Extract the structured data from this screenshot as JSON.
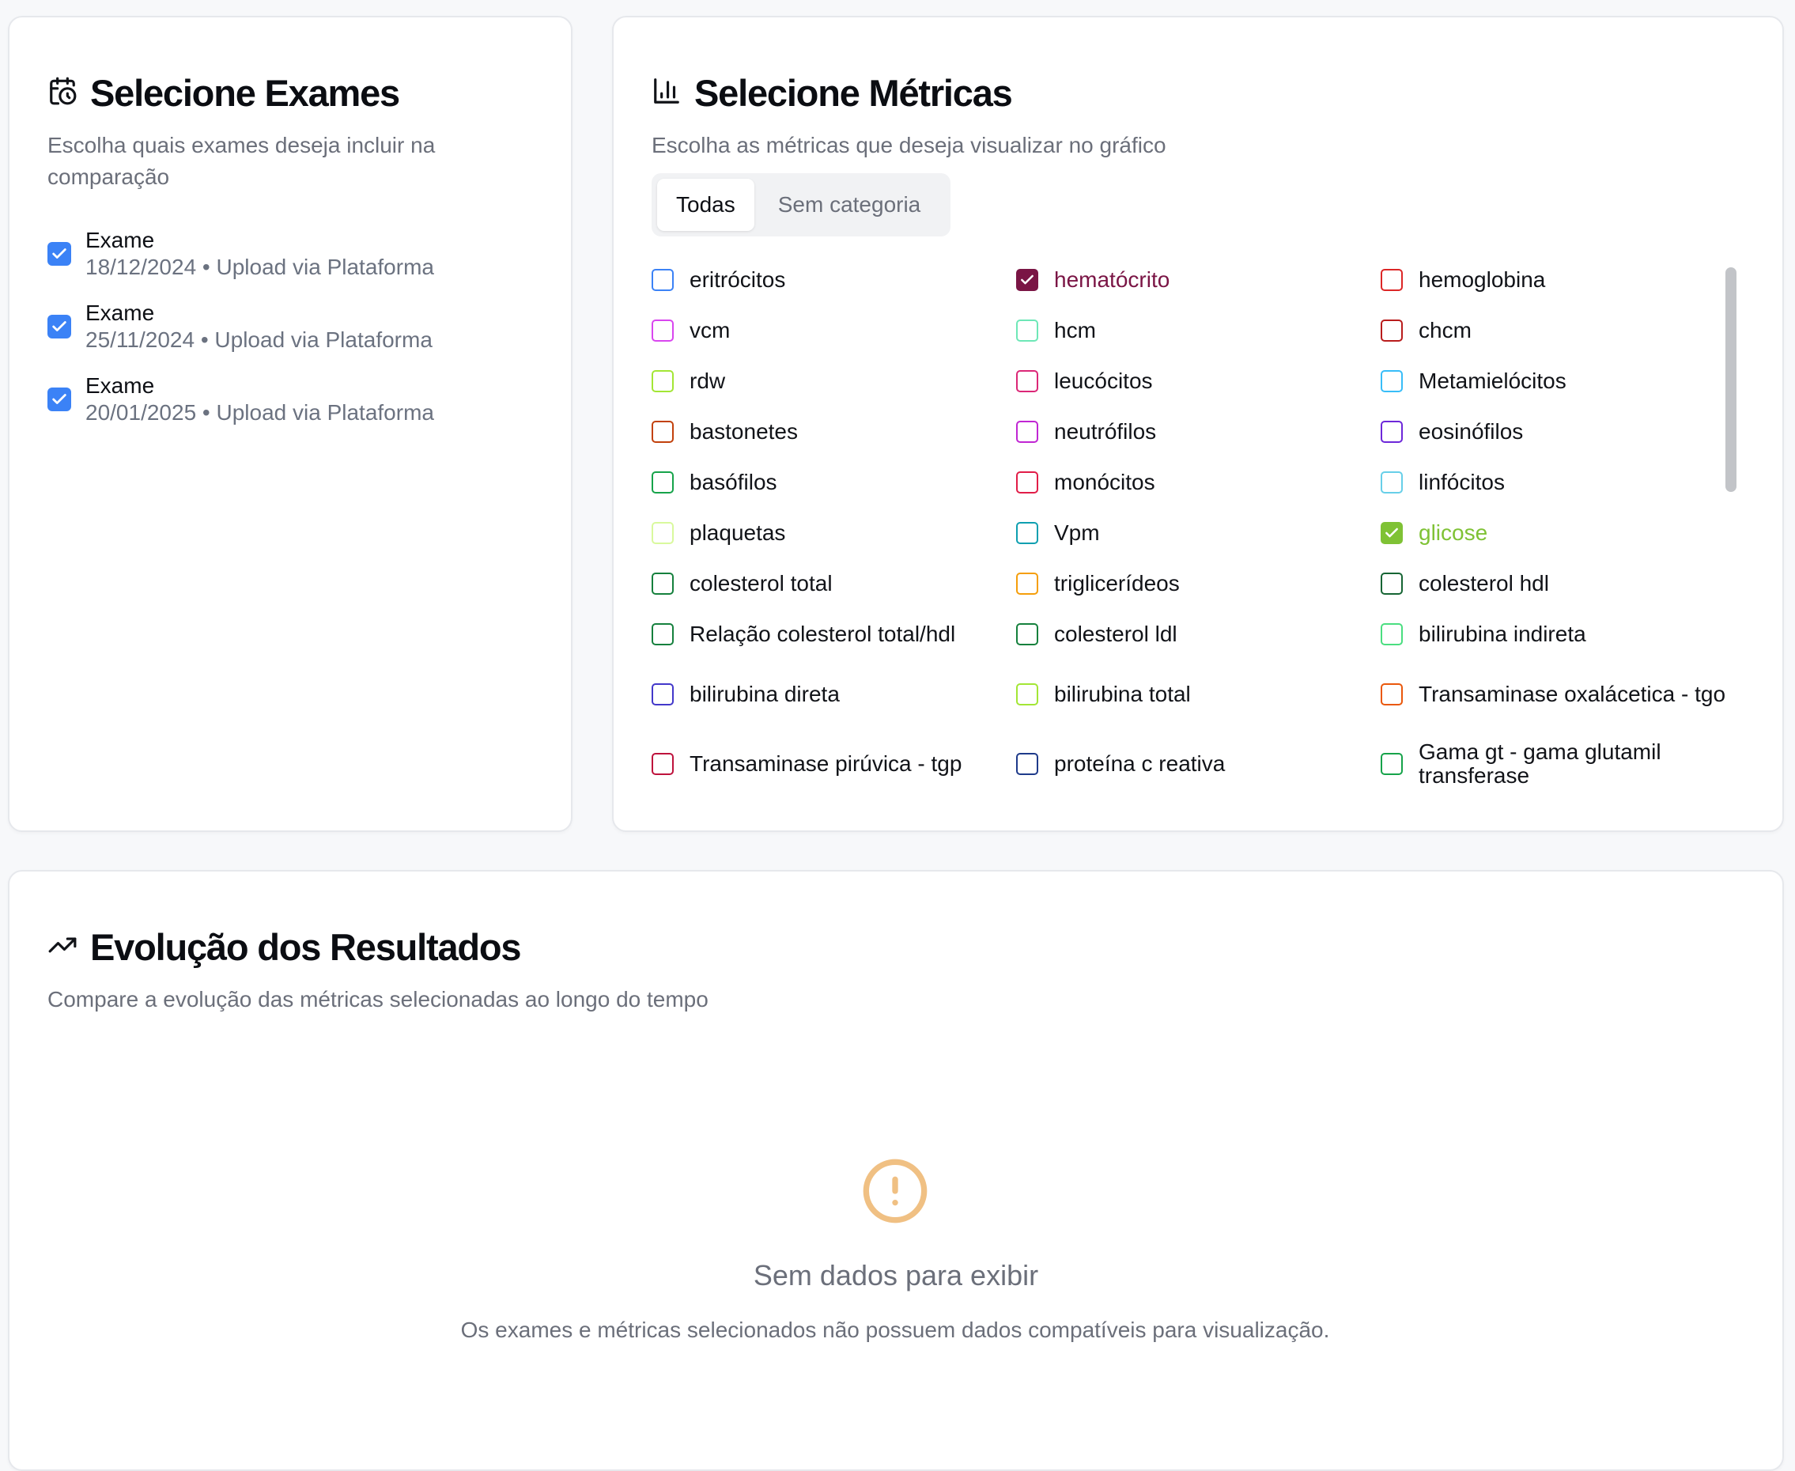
{
  "exams_panel": {
    "title": "Selecione Exames",
    "description": "Escolha quais exames deseja incluir na comparação",
    "items": [
      {
        "name": "Exame",
        "meta": "18/12/2024 • Upload via Plataforma",
        "checked": true
      },
      {
        "name": "Exame",
        "meta": "25/11/2024 • Upload via Plataforma",
        "checked": true
      },
      {
        "name": "Exame",
        "meta": "20/01/2025 • Upload via Plataforma",
        "checked": true
      }
    ]
  },
  "metrics_panel": {
    "title": "Selecione Métricas",
    "description": "Escolha as métricas que deseja visualizar no gráfico",
    "tabs": [
      {
        "label": "Todas",
        "active": true
      },
      {
        "label": "Sem categoria",
        "active": false
      }
    ],
    "metrics": [
      {
        "label": "eritrócitos",
        "color": "#3b82f6",
        "checked": false
      },
      {
        "label": "hematócrito",
        "color": "#7a1545",
        "checked": true
      },
      {
        "label": "hemoglobina",
        "color": "#dc2626",
        "checked": false
      },
      {
        "label": "vcm",
        "color": "#d946ef",
        "checked": false
      },
      {
        "label": "hcm",
        "color": "#6ee7b7",
        "checked": false
      },
      {
        "label": "chcm",
        "color": "#b91c1c",
        "checked": false
      },
      {
        "label": "rdw",
        "color": "#a3e635",
        "checked": false
      },
      {
        "label": "leucócitos",
        "color": "#db2777",
        "checked": false
      },
      {
        "label": "Metamielócitos",
        "color": "#38bdf8",
        "checked": false
      },
      {
        "label": "bastonetes",
        "color": "#c2410c",
        "checked": false
      },
      {
        "label": "neutrófilos",
        "color": "#c026d3",
        "checked": false
      },
      {
        "label": "eosinófilos",
        "color": "#6d28d9",
        "checked": false
      },
      {
        "label": "basófilos",
        "color": "#16a34a",
        "checked": false
      },
      {
        "label": "monócitos",
        "color": "#e11d48",
        "checked": false
      },
      {
        "label": "linfócitos",
        "color": "#67cfe8",
        "checked": false
      },
      {
        "label": "plaquetas",
        "color": "#d9f99d",
        "checked": false
      },
      {
        "label": "Vpm",
        "color": "#0e9fb0",
        "checked": false
      },
      {
        "label": "glicose",
        "color": "#7fc235",
        "checked": true
      },
      {
        "label": "colesterol total",
        "color": "#15803d",
        "checked": false
      },
      {
        "label": "triglicerídeos",
        "color": "#f59e0b",
        "checked": false
      },
      {
        "label": "colesterol hdl",
        "color": "#166534",
        "checked": false
      },
      {
        "label": "Relação colesterol total/hdl",
        "color": "#15803d",
        "checked": false
      },
      {
        "label": "colesterol ldl",
        "color": "#15803d",
        "checked": false
      },
      {
        "label": "bilirubina indireta",
        "color": "#4ade80",
        "checked": false
      },
      {
        "label": "bilirubina direta",
        "color": "#4338ca",
        "checked": false
      },
      {
        "label": "bilirubina total",
        "color": "#a3e635",
        "checked": false
      },
      {
        "label": "Transaminase oxalácetica - tgo",
        "color": "#ea580c",
        "checked": false
      },
      {
        "label": "Transaminase pirúvica - tgp",
        "color": "#be123c",
        "checked": false
      },
      {
        "label": "proteína c reativa",
        "color": "#1e3a8a",
        "checked": false
      },
      {
        "label": "Gama gt - gama glutamil transferase",
        "color": "#16a34a",
        "checked": false
      }
    ]
  },
  "chart_panel": {
    "title": "Evolução dos Resultados",
    "description": "Compare a evolução das métricas selecionadas ao longo do tempo",
    "empty_title": "Sem dados para exibir",
    "empty_description": "Os exames e métricas selecionados não possuem dados compatíveis para visualização.",
    "empty_icon": "alert-circle-icon",
    "empty_icon_color": "#f0c083"
  },
  "colors": {
    "exam_checkbox": "#3b82f6"
  }
}
